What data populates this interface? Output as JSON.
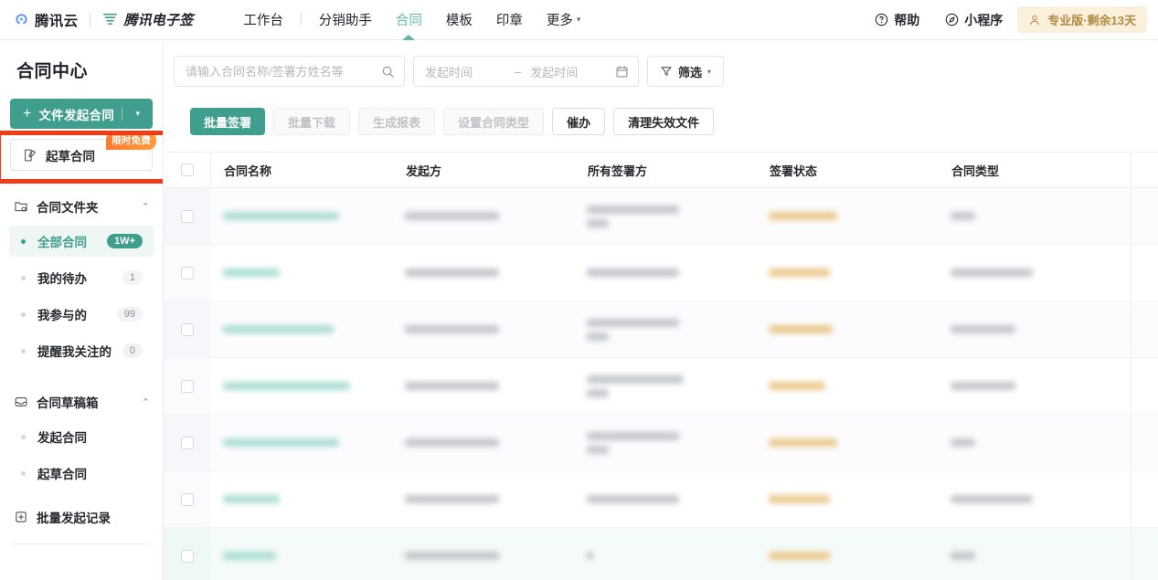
{
  "topbar": {
    "cloud_brand": "腾讯云",
    "esign_brand": "腾讯电子签",
    "nav": [
      {
        "label": "工作台",
        "active": false
      },
      {
        "label": "分销助手",
        "active": false
      },
      {
        "label": "合同",
        "active": true
      },
      {
        "label": "模板",
        "active": false
      },
      {
        "label": "印章",
        "active": false
      },
      {
        "label": "更多",
        "active": false,
        "caret": "▾"
      }
    ],
    "help_label": "帮助",
    "miniprogram_label": "小程序",
    "pro_badge": "专业版·剩余13天",
    "icons": {
      "help": "question-circle-icon",
      "miniprogram": "compass-icon",
      "pro": "user-crown-icon"
    },
    "colors": {
      "accent": "#5fb8ab",
      "badge_bg": "#faf0dc",
      "badge_text": "#b08a3e"
    }
  },
  "sidebar": {
    "title": "合同中心",
    "primary_button": {
      "label": "文件发起合同",
      "plus": "+",
      "caret": "▾"
    },
    "draft_button": {
      "label": "起草合同",
      "badge": "限时免费",
      "icon": "edit-document-icon"
    },
    "groups": [
      {
        "label": "合同文件夹",
        "icon": "folder-icon",
        "caret": "⌃",
        "items": [
          {
            "label": "全部合同",
            "count": "1W+",
            "active": true
          },
          {
            "label": "我的待办",
            "count": "1",
            "active": false
          },
          {
            "label": "我参与的",
            "count": "99",
            "active": false
          },
          {
            "label": "提醒我关注的",
            "count": "0",
            "active": false
          }
        ]
      },
      {
        "label": "合同草稿箱",
        "icon": "inbox-icon",
        "caret": "⌃",
        "items": [
          {
            "label": "发起合同",
            "count": "",
            "active": false
          },
          {
            "label": "起草合同",
            "count": "",
            "active": false
          }
        ]
      }
    ],
    "leaf_items": [
      {
        "label": "批量发起记录",
        "icon": "batch-send-icon"
      }
    ],
    "colors": {
      "primary": "#3f9e8e",
      "active_bg": "#eef7f4",
      "badge_orange": "#ff7a2f"
    }
  },
  "annotation": {
    "color": "#f03d18",
    "target": "起草合同"
  },
  "toolbar": {
    "search": {
      "value": "",
      "placeholder": "请输入合同名称/签署方姓名等",
      "icon": "search-icon"
    },
    "date_range": {
      "start_placeholder": "发起时间",
      "end_placeholder": "发起时间",
      "separator": "–",
      "icon": "calendar-icon"
    },
    "filter": {
      "label": "筛选",
      "icon": "filter-icon",
      "caret": "▾"
    }
  },
  "actions": [
    {
      "label": "批量签署",
      "state": "primary"
    },
    {
      "label": "批量下载",
      "state": "disabled"
    },
    {
      "label": "生成报表",
      "state": "disabled"
    },
    {
      "label": "设置合同类型",
      "state": "disabled"
    },
    {
      "label": "催办",
      "state": "normal"
    },
    {
      "label": "清理失效文件",
      "state": "normal"
    }
  ],
  "table": {
    "select_all_checkbox": false,
    "columns": [
      {
        "label": "合同名称",
        "key": "name"
      },
      {
        "label": "发起方",
        "key": "initiator"
      },
      {
        "label": "所有签署方",
        "key": "signers"
      },
      {
        "label": "签署状态",
        "key": "status"
      },
      {
        "label": "合同类型",
        "key": "type"
      }
    ],
    "redacted": true,
    "rows": [
      {
        "highlight": "alt",
        "name_w": 127,
        "initiator_w": 103,
        "signers": [
          101,
          24
        ],
        "status_w": 75,
        "type_w": 27
      },
      {
        "highlight": "none",
        "name_w": 62,
        "initiator_w": 103,
        "signers": [
          101
        ],
        "status_w": 67,
        "type_w": 90
      },
      {
        "highlight": "alt",
        "name_w": 121,
        "initiator_w": 103,
        "signers": [
          101,
          24
        ],
        "status_w": 70,
        "type_w": 71
      },
      {
        "highlight": "none",
        "name_w": 139,
        "initiator_w": 103,
        "signers": [
          106,
          24
        ],
        "status_w": 62,
        "type_w": 71
      },
      {
        "highlight": "alt",
        "name_w": 127,
        "initiator_w": 103,
        "signers": [
          101,
          24
        ],
        "status_w": 75,
        "type_w": 27
      },
      {
        "highlight": "none",
        "name_w": 62,
        "initiator_w": 103,
        "signers": [
          101
        ],
        "status_w": 67,
        "type_w": 90
      },
      {
        "highlight": "hl",
        "name_w": 58,
        "initiator_w": 103,
        "signers": [
          7
        ],
        "status_w": 67,
        "type_w": 27
      }
    ]
  }
}
